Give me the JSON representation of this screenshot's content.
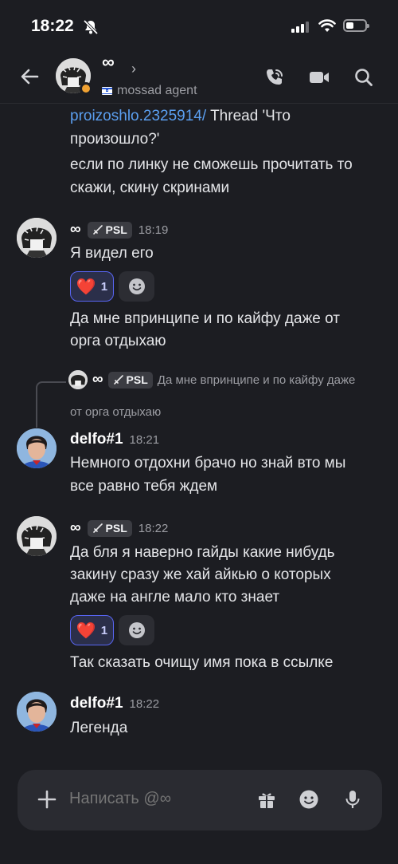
{
  "status_bar": {
    "time": "18:22"
  },
  "header": {
    "title": "∞",
    "subtitle": "mossad agent"
  },
  "messages": {
    "m0": {
      "link": "proizoshlo.2325914/",
      "line1_rest": " Thread 'Что",
      "line2": "произошло?'",
      "line3": "если по линку не сможешь прочитать то",
      "line4": "скажи, скину скринами"
    },
    "m1": {
      "author": "∞",
      "tag": "PSL",
      "time": "18:19",
      "text1": "Я видел его",
      "reaction": {
        "emoji": "❤️",
        "count": "1"
      },
      "text2_line1": "Да мне впринципе и по кайфу даже от",
      "text2_line2": "орга отдыхаю"
    },
    "m2": {
      "reply": {
        "author": "∞",
        "tag": "PSL",
        "text_line1": "Да мне впринципе и по кайфу даже",
        "text_line2": "от орга отдыхаю"
      },
      "author": "delfo#1",
      "time": "18:21",
      "line1": "Немного отдохни брачо но знай вто мы",
      "line2": "все равно тебя ждем"
    },
    "m3": {
      "author": "∞",
      "tag": "PSL",
      "time": "18:22",
      "line1": "Да бля я наверно гайды какие нибудь",
      "line2": "закину сразу же хай айкью о которых",
      "line3": "даже на англе мало кто знает",
      "reaction": {
        "emoji": "❤️",
        "count": "1"
      },
      "text2": "Так сказать очищу имя пока в ссылке"
    },
    "m4": {
      "author": "delfo#1",
      "time": "18:22",
      "text": "Легенда"
    }
  },
  "composer": {
    "placeholder": "Написать @∞"
  },
  "colors": {
    "accent": "#5865f2",
    "link": "#5b9ff0",
    "background": "#1c1d22",
    "idle": "#f0a232"
  }
}
